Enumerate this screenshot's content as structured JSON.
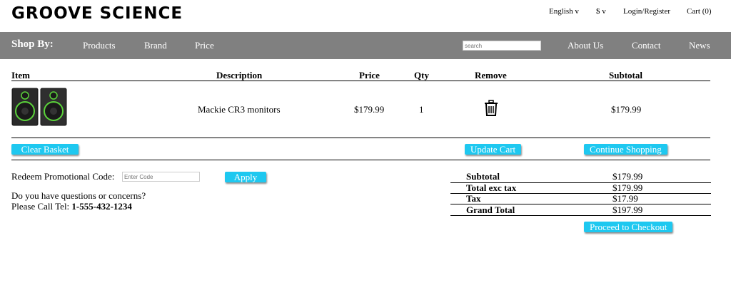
{
  "header": {
    "logo": "GROOVE SCIENCE",
    "language": "English v",
    "currency": "$ v",
    "login": "Login/Register",
    "cart": "Cart (0)"
  },
  "nav": {
    "shop_by": "Shop By:",
    "products": "Products",
    "brand": "Brand",
    "price": "Price",
    "search_placeholder": "search",
    "about": "About Us",
    "contact": "Contact",
    "news": "News"
  },
  "table": {
    "headers": [
      "Item",
      "Description",
      "Price",
      "Qty",
      "Remove",
      "Subtotal"
    ],
    "row": {
      "image": "speaker-monitors-image",
      "description": "Mackie CR3 monitors",
      "price": "$179.99",
      "qty": "1",
      "remove_icon": "trash-icon",
      "subtotal": "$179.99"
    }
  },
  "actions": {
    "clear": "Clear Basket",
    "update": "Update Cart",
    "continue": "Continue Shopping"
  },
  "promo": {
    "label": "Redeem Promotional Code:",
    "placeholder": "Enter Code",
    "apply": "Apply"
  },
  "help": {
    "question": "Do you have questions or concerns?",
    "call_label": "Please Call Tel: ",
    "phone": "1-555-432-1234"
  },
  "summary": {
    "rows": [
      {
        "label": "Subtotal",
        "value": "$179.99"
      },
      {
        "label": "Total exc tax",
        "value": "$179.99"
      },
      {
        "label": "Tax",
        "value": "$17.99"
      },
      {
        "label": "Grand Total",
        "value": "$197.99"
      }
    ],
    "checkout": "Proceed to Checkout"
  },
  "colors": {
    "nav_bg": "#808080",
    "button_bg": "#1ec8f0"
  }
}
